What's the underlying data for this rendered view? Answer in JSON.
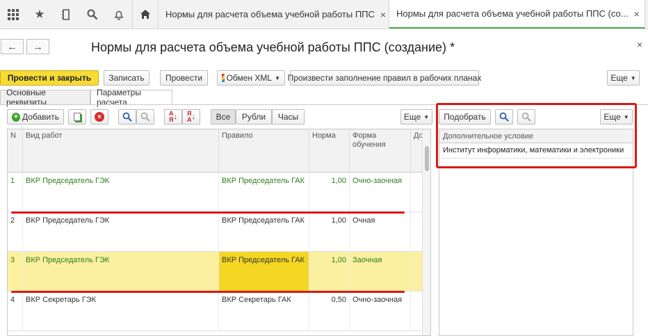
{
  "topbar": {
    "icons": [
      "apps-grid-icon",
      "star-icon",
      "history-icon",
      "search-icon",
      "bell-icon"
    ],
    "home_icon": "home-icon",
    "tabs": [
      {
        "label": "Нормы для расчета объема учебной работы ППС",
        "close": "×"
      },
      {
        "label": "Нормы для расчета объема учебной работы ППС (со...",
        "close": "×"
      }
    ]
  },
  "window": {
    "title": "Нормы для расчета объема учебной работы ППС (создание) *",
    "back": "←",
    "forward": "→",
    "close": "×"
  },
  "toolbar": {
    "post_close": "Провести и закрыть",
    "save": "Записать",
    "post": "Провести",
    "xml": "Обмен XML",
    "fill_rules": "Произвести заполнение правил в рабочих планах",
    "more": "Еще"
  },
  "form_tabs": [
    "Основные реквизиты",
    "Параметры расчета"
  ],
  "grid_toolbar": {
    "add": "Добавить",
    "filters": [
      "Все",
      "Рубли",
      "Часы"
    ],
    "more": "Еще"
  },
  "table": {
    "columns": [
      "N",
      "Вид работ",
      "Правило",
      "Норма",
      "Форма обучения",
      "До"
    ],
    "rows": [
      {
        "n": "1",
        "work": "ВКР Председатель ГЭК",
        "rule": "ВКР Председатель ГАК",
        "norm": "1,00",
        "form": "Очно-заочная",
        "style": "green"
      },
      {
        "n": "2",
        "work": "ВКР Председатель ГЭК",
        "rule": "ВКР Председатель ГАК",
        "norm": "1,00",
        "form": "Очная",
        "style": "normal"
      },
      {
        "n": "3",
        "work": "ВКР Председатель ГЭК",
        "rule": "ВКР Председатель ГАК",
        "norm": "1,00",
        "form": "Заочная",
        "style": "selected"
      },
      {
        "n": "4",
        "work": "ВКР Секретарь ГЭК",
        "rule": "ВКР Секретарь ГАК",
        "norm": "0,50",
        "form": "Очно-заочная",
        "style": "normal"
      }
    ]
  },
  "right_panel": {
    "pick": "Подобрать",
    "more": "Еще",
    "column": "Дополнительное условие",
    "rows": [
      "Институт информатики, математики и электроники"
    ]
  },
  "colors": {
    "accent_yellow": "#f8dc35",
    "green_text": "#2e7d1a",
    "highlight_red": "#d61a1a",
    "selected_row": "#fbf0a0"
  }
}
